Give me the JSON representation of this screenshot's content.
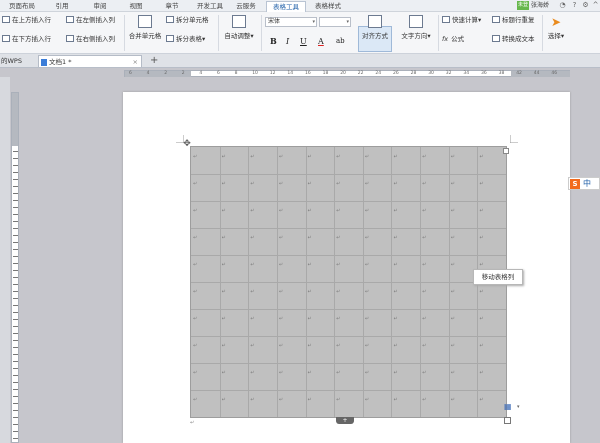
{
  "ribbon_tabs": [
    {
      "label": "页面布局",
      "active": false
    },
    {
      "label": "引用",
      "active": false
    },
    {
      "label": "审阅",
      "active": false
    },
    {
      "label": "视图",
      "active": false
    },
    {
      "label": "章节",
      "active": false
    },
    {
      "label": "开发工具",
      "active": false
    },
    {
      "label": "云服务",
      "active": false
    },
    {
      "label": "表格工具",
      "active": true
    },
    {
      "label": "表格样式",
      "active": false
    }
  ],
  "user": {
    "badge": "未登",
    "name": "张海娇"
  },
  "ribbon": {
    "insert_above": "在上方插入行",
    "insert_left": "在左侧插入列",
    "insert_below": "在下方插入行",
    "insert_right": "在右侧插入列",
    "merge_cells": "合并单元格",
    "split_cells": "拆分单元格",
    "split_table": "拆分表格",
    "auto_fit": "自动调整",
    "font_name": "宋体",
    "font_size": "",
    "bold": "B",
    "italic": "I",
    "underline": "U",
    "font_color": "A",
    "highlight": "ab",
    "align": "对齐方式",
    "text_direction": "文字方向",
    "quick_calc": "快速计算",
    "title_repeat": "标题行重复",
    "formula": "公式",
    "to_text": "转换成文本",
    "select": "选择"
  },
  "doc_tabs": {
    "left_partial": "的WPS",
    "doc_name": "文档1 *",
    "close": "×",
    "new": "+"
  },
  "ruler": {
    "marks": [
      "6",
      "4",
      "2",
      "2",
      "4",
      "6",
      "8",
      "10",
      "12",
      "14",
      "16",
      "18",
      "20",
      "22",
      "24",
      "26",
      "28",
      "30",
      "32",
      "34",
      "36",
      "38",
      "42",
      "44",
      "46"
    ]
  },
  "table": {
    "rows": 10,
    "cols": 11,
    "paragraph_mark": "↵"
  },
  "tooltip": "移动表格列",
  "ime": {
    "logo": "S",
    "mode": "中"
  },
  "colors": {
    "active_tab": "#1f5fa8",
    "table_fill": "#c0c0c0",
    "ime_logo": "#f26b1d"
  }
}
